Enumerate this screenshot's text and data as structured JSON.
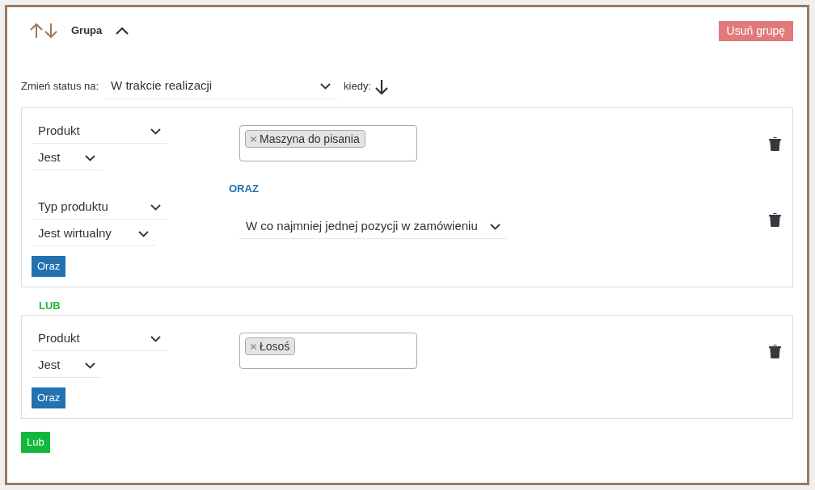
{
  "header": {
    "title": "Grupa",
    "delete_button": "Usuń grupę"
  },
  "status": {
    "label": "Zmień status na:",
    "value": "W trakcie realizacji",
    "when_label": "kiedy:"
  },
  "groups": [
    {
      "conditions": [
        {
          "field": "Produkt",
          "operator": "Jest",
          "value": {
            "kind": "tags",
            "tags": [
              "Maszyna do pisania"
            ]
          }
        },
        {
          "joiner": "ORAZ",
          "field": "Typ produktu",
          "operator": "Jest wirtualny",
          "value": {
            "kind": "select",
            "text": "W co najmniej jednej pozycji w zamówieniu"
          }
        }
      ],
      "and_button": "Oraz"
    },
    {
      "conditions": [
        {
          "field": "Produkt",
          "operator": "Jest",
          "value": {
            "kind": "tags",
            "tags": [
              "Łosoś"
            ]
          }
        }
      ],
      "and_button": "Oraz"
    }
  ],
  "or_label": "LUB",
  "or_button": "Lub"
}
